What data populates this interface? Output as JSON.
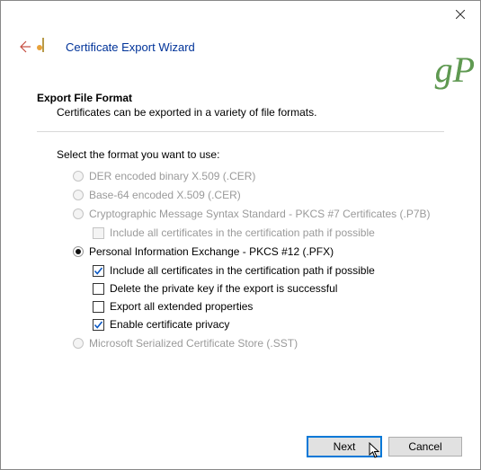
{
  "window": {
    "wizard_title": "Certificate Export Wizard",
    "watermark": "gP"
  },
  "page": {
    "heading": "Export File Format",
    "subheading": "Certificates can be exported in a variety of file formats.",
    "prompt": "Select the format you want to use:"
  },
  "options": {
    "der": {
      "label": "DER encoded binary X.509 (.CER)",
      "enabled": false,
      "selected": false
    },
    "base64": {
      "label": "Base-64 encoded X.509 (.CER)",
      "enabled": false,
      "selected": false
    },
    "pkcs7": {
      "label": "Cryptographic Message Syntax Standard - PKCS #7 Certificates (.P7B)",
      "enabled": false,
      "selected": false,
      "sub": {
        "include_chain": {
          "label": "Include all certificates in the certification path if possible",
          "enabled": false,
          "checked": false
        }
      }
    },
    "pfx": {
      "label": "Personal Information Exchange - PKCS #12 (.PFX)",
      "enabled": true,
      "selected": true,
      "sub": {
        "include_chain": {
          "label": "Include all certificates in the certification path if possible",
          "enabled": true,
          "checked": true
        },
        "delete_key": {
          "label": "Delete the private key if the export is successful",
          "enabled": true,
          "checked": false
        },
        "export_ext": {
          "label": "Export all extended properties",
          "enabled": true,
          "checked": false
        },
        "cert_privacy": {
          "label": "Enable certificate privacy",
          "enabled": true,
          "checked": true
        }
      }
    },
    "sst": {
      "label": "Microsoft Serialized Certificate Store (.SST)",
      "enabled": false,
      "selected": false
    }
  },
  "footer": {
    "next_label": "Next",
    "cancel_label": "Cancel"
  }
}
